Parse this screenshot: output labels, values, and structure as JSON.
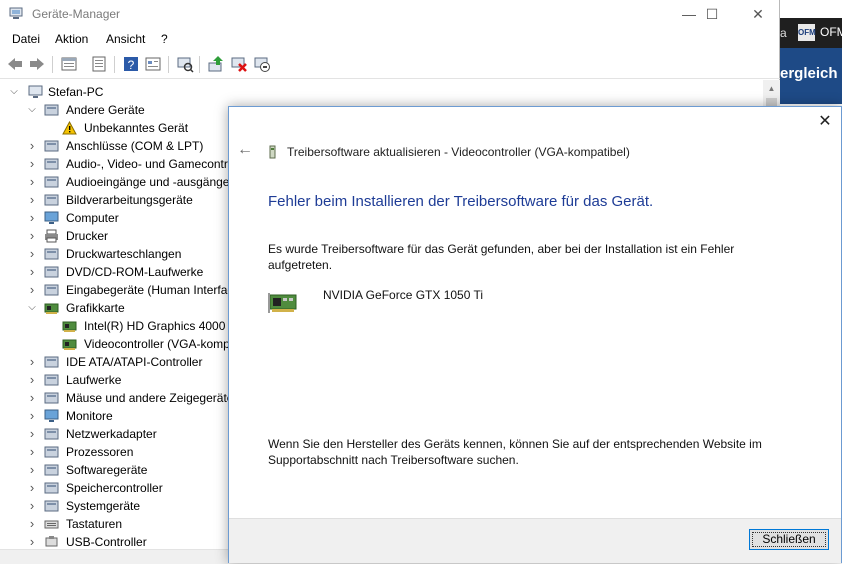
{
  "background": {
    "topbar_partial": "a",
    "logo_text": "OFM",
    "topbar_label": "OFM",
    "banner_partial": "ergleich"
  },
  "window": {
    "title": "Geräte-Manager",
    "controls": {
      "minimize": "—",
      "maximize": "☐",
      "close": "✕"
    }
  },
  "menu": [
    "Datei",
    "Aktion",
    "Ansicht",
    "?"
  ],
  "toolbar": [
    {
      "name": "back-icon"
    },
    {
      "name": "forward-icon"
    },
    {
      "name": "properties-icon"
    },
    {
      "name": "view-list-icon"
    },
    {
      "name": "help-icon"
    },
    {
      "name": "details-icon"
    },
    {
      "name": "scan-hardware-icon"
    },
    {
      "name": "update-driver-icon"
    },
    {
      "name": "uninstall-device-icon"
    },
    {
      "name": "disable-device-icon"
    }
  ],
  "tree": {
    "root": "Stefan-PC",
    "items": [
      {
        "label": "Andere Geräte",
        "expanded": true,
        "icon": "unknown-device-icon"
      },
      {
        "label": "Unbekanntes Gerät",
        "child": true,
        "icon": "warning-device-icon"
      },
      {
        "label": "Anschlüsse (COM & LPT)",
        "icon": "port-icon"
      },
      {
        "label": "Audio-, Video- und Gamecontroller",
        "icon": "audio-icon"
      },
      {
        "label": "Audioeingänge und -ausgänge",
        "icon": "speaker-icon"
      },
      {
        "label": "Bildverarbeitungsgeräte",
        "icon": "camera-icon"
      },
      {
        "label": "Computer",
        "icon": "computer-icon"
      },
      {
        "label": "Drucker",
        "icon": "printer-icon"
      },
      {
        "label": "Druckwarteschlangen",
        "icon": "print-queue-icon"
      },
      {
        "label": "DVD/CD-ROM-Laufwerke",
        "icon": "disc-drive-icon"
      },
      {
        "label": "Eingabegeräte (Human Interface Devices)",
        "icon": "hid-icon"
      },
      {
        "label": "Grafikkarte",
        "expanded": true,
        "icon": "display-adapter-icon"
      },
      {
        "label": "Intel(R) HD Graphics 4000",
        "child": true,
        "icon": "display-adapter-icon"
      },
      {
        "label": "Videocontroller (VGA-kompatibel)",
        "child": true,
        "icon": "display-adapter-icon"
      },
      {
        "label": "IDE ATA/ATAPI-Controller",
        "icon": "ide-controller-icon"
      },
      {
        "label": "Laufwerke",
        "icon": "disk-drive-icon"
      },
      {
        "label": "Mäuse und andere Zeigegeräte",
        "icon": "mouse-icon"
      },
      {
        "label": "Monitore",
        "icon": "monitor-icon"
      },
      {
        "label": "Netzwerkadapter",
        "icon": "network-adapter-icon"
      },
      {
        "label": "Prozessoren",
        "icon": "processor-icon"
      },
      {
        "label": "Softwaregeräte",
        "icon": "software-device-icon"
      },
      {
        "label": "Speichercontroller",
        "icon": "storage-controller-icon"
      },
      {
        "label": "Systemgeräte",
        "icon": "system-device-icon"
      },
      {
        "label": "Tastaturen",
        "icon": "keyboard-icon"
      },
      {
        "label": "USB-Controller",
        "icon": "usb-icon"
      }
    ]
  },
  "dialog": {
    "title": "Treibersoftware aktualisieren - Videocontroller (VGA-kompatibel)",
    "heading": "Fehler beim Installieren der Treibersoftware für das Gerät.",
    "message": "Es wurde Treibersoftware für das Gerät gefunden, aber bei der Installation ist ein Fehler aufgetreten.",
    "device_name": "NVIDIA GeForce GTX 1050 Ti",
    "hint": "Wenn Sie den Hersteller des Geräts kennen, können Sie auf der entsprechenden Website im Supportabschnitt nach Treibersoftware suchen.",
    "close_button": "Schließen",
    "close_glyph": "✕",
    "back_glyph": "←"
  }
}
